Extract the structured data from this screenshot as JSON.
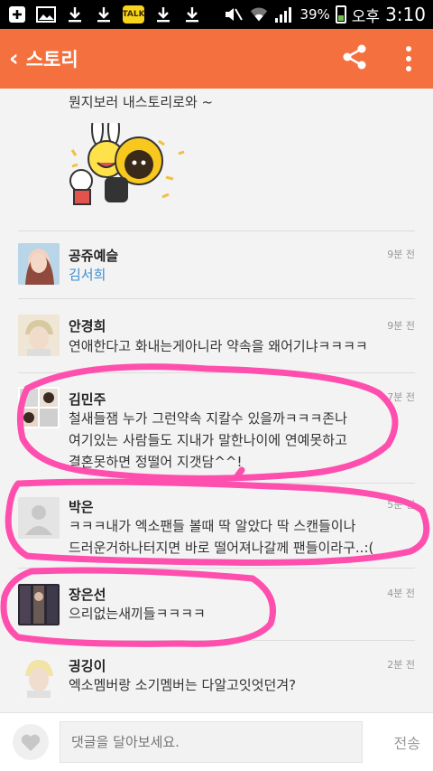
{
  "statusbar": {
    "battery": "39%",
    "ampm": "오후",
    "time": "3:10",
    "icons": [
      "add-icon",
      "image-icon",
      "download-icon",
      "download-icon",
      "kakaotalk-icon",
      "download-icon",
      "download-icon",
      "mute-icon",
      "wifi-icon",
      "signal-icon",
      "battery-icon"
    ],
    "talk_label": "TALK"
  },
  "appbar": {
    "title": "스토리",
    "actions": [
      "share-icon",
      "more-icon"
    ],
    "color": "#f4713f"
  },
  "post": {
    "tail_text": "뭔지보러 내스토리로와 ~"
  },
  "comments": [
    {
      "name": "공쥬예슬",
      "time": "9분 전",
      "text": "김서희",
      "is_mention": true
    },
    {
      "name": "안경희",
      "time": "9분 전",
      "text": "연애한다고 화내는게아니라 약속을 왜어기냐ㅋㅋㅋㅋ"
    },
    {
      "name": "김민주",
      "time": "7분 전",
      "lines": [
        "철새들잼 누가 그런약속 지칼수 있을까ㅋㅋㅋ존나",
        "여기있는 사람들도 지내가 말한나이에 연예못하고",
        "결혼못하면 정떨어 지갯담^^!"
      ]
    },
    {
      "name": "박은",
      "time": "5분 전",
      "lines": [
        "ㅋㅋㅋ내가 엑소팬들 볼때 딱 알았다 딱 스캔들이나",
        "드러운거하나터지면 바로 떨어져나갈께 팬들이라구..:("
      ]
    },
    {
      "name": "장은선",
      "time": "4분 전",
      "text": "으리없는새끼들ㅋㅋㅋㅋ"
    },
    {
      "name": "긩깅이",
      "time": "2분 전",
      "text": "엑소멤버랑 소기멤버는 다알고잇엇던겨?"
    }
  ],
  "composer": {
    "placeholder": "댓글을 달아보세요.",
    "send_label": "전송"
  },
  "colors": {
    "accent": "#f4713f",
    "annotation": "#ff4fae",
    "mention": "#3a8ccf"
  }
}
